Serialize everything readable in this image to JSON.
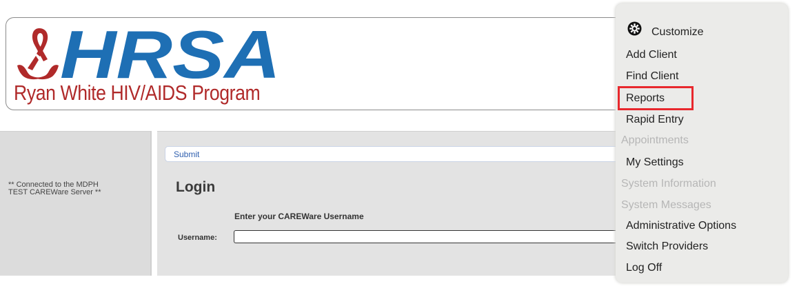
{
  "header": {
    "logo_text": "HRSA",
    "program_name": "Ryan White HIV/AIDS Program"
  },
  "left_panel": {
    "server_note": "** Connected to the MDPH TEST CAREWare Server **"
  },
  "main": {
    "submit_label": "Submit",
    "login_title": "Login",
    "username_prompt": "Enter your CAREWare Username",
    "username_label": "Username:",
    "username_value": ""
  },
  "menu": {
    "customize_label": "Customize",
    "items": [
      {
        "label": "Add Client",
        "enabled": true
      },
      {
        "label": "Find Client",
        "enabled": true
      },
      {
        "label": "Reports",
        "enabled": true,
        "highlighted": true
      },
      {
        "label": "Rapid Entry",
        "enabled": true
      },
      {
        "label": "Appointments",
        "enabled": false
      },
      {
        "label": "My Settings",
        "enabled": true
      },
      {
        "label": "System Information",
        "enabled": false
      },
      {
        "label": "System Messages",
        "enabled": false
      },
      {
        "label": "Administrative Options",
        "enabled": true
      },
      {
        "label": "Switch Providers",
        "enabled": true
      },
      {
        "label": "Log Off",
        "enabled": true
      }
    ]
  },
  "colors": {
    "brand_blue": "#1e6fb4",
    "brand_red": "#b02a2a",
    "highlight_red": "#e8282d",
    "disabled_gray": "#b6b6b6"
  },
  "icons": {
    "customize": "gear-icon",
    "logo_ribbon": "ribbon-hands-icon"
  }
}
